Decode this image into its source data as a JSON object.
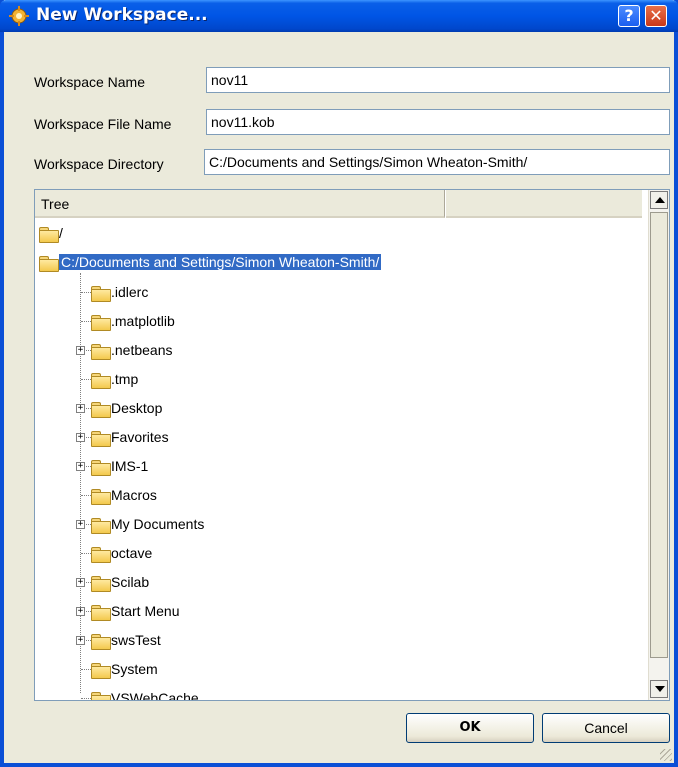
{
  "window": {
    "title": "New Workspace...",
    "help_label": "?",
    "close_label": "✕"
  },
  "fields": {
    "name_label": "Workspace Name",
    "name_value": "nov11",
    "file_label": "Workspace File Name",
    "file_value": "nov11.kob",
    "dir_label": "Workspace Directory",
    "dir_value": "C:/Documents and Settings/Simon Wheaton-Smith/"
  },
  "tree": {
    "header": "Tree",
    "root": "/",
    "selected": "C:/Documents and Settings/Simon Wheaton-Smith/",
    "children": [
      {
        "label": ".idlerc",
        "expandable": false
      },
      {
        "label": ".matplotlib",
        "expandable": false
      },
      {
        "label": ".netbeans",
        "expandable": true
      },
      {
        "label": ".tmp",
        "expandable": false
      },
      {
        "label": "Desktop",
        "expandable": true
      },
      {
        "label": "Favorites",
        "expandable": true
      },
      {
        "label": "IMS-1",
        "expandable": true
      },
      {
        "label": "Macros",
        "expandable": false
      },
      {
        "label": "My Documents",
        "expandable": true
      },
      {
        "label": "octave",
        "expandable": false
      },
      {
        "label": "Scilab",
        "expandable": true
      },
      {
        "label": "Start Menu",
        "expandable": true
      },
      {
        "label": "swsTest",
        "expandable": true
      },
      {
        "label": "System",
        "expandable": false
      },
      {
        "label": "VSWebCache",
        "expandable": false
      }
    ]
  },
  "buttons": {
    "ok": "OK",
    "cancel": "Cancel"
  },
  "colors": {
    "titlebar": "#0055e5",
    "selection": "#316ac5",
    "dialog_bg": "#ebeadb"
  }
}
